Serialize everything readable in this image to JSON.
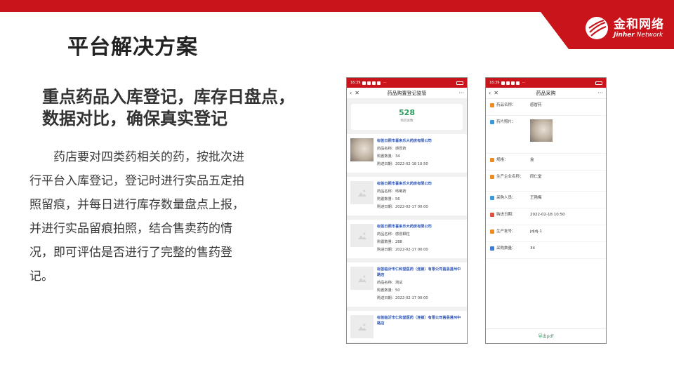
{
  "slide": {
    "title": "平台解决方案",
    "headline_line1": "重点药品入库登记，库存日盘点，",
    "headline_line2": "数据对比，确保真实登记",
    "body": "药店要对四类药相关的药，按批次进行平台入库登记，登记时进行实品五定拍照留痕，并每日进行库存数量盘点上报，并进行实品留痕拍照，结合售卖药的情况，即可评估是否进行了完整的售药登记。"
  },
  "brand": {
    "name_cn": "金和网络",
    "name_en_bold": "Jinher",
    "name_en_rest": "Network",
    "color": "#c8141a"
  },
  "left_phone": {
    "status_time": "16:39",
    "status_more": "···",
    "back_icon": "‹",
    "close_icon": "✕",
    "title": "药品购置登记监管",
    "more_icon": "···",
    "total_count": "528",
    "total_label": "购药总数",
    "records": [
      {
        "store": "标签日照市喜来乐大药房有限公司",
        "name": "药品名称：感冒药",
        "quantity": "购置数量：34",
        "date": "购进日期：2022-02-18 10:50",
        "has_photo": true
      },
      {
        "store": "标签日照市喜来乐大药房有限公司",
        "name": "药品名称：咳嗽药",
        "quantity": "购置数量：56",
        "date": "购进日期：2022-02-17 00:00",
        "has_photo": false
      },
      {
        "store": "标签日照市喜来乐大药房有限公司",
        "name": "药品名称：感冒颗粒",
        "quantity": "购置数量：288",
        "date": "购进日期：2022-02-17 00:00",
        "has_photo": false
      },
      {
        "store": "标签临沂市仁和堂医药（连锁）有限公司莒县莒州中路店",
        "name": "药品名称：测试",
        "quantity": "购置数量：50",
        "date": "购进日期：2022-02-17 00:00",
        "has_photo": false
      },
      {
        "store": "标签临沂市仁和堂医药（连锁）有限公司莒县莒州中路店",
        "name": "",
        "quantity": "",
        "date": "",
        "has_photo": false
      }
    ]
  },
  "right_phone": {
    "status_time": "16:39",
    "status_more": "···",
    "back_icon": "‹",
    "close_icon": "✕",
    "title": "药品采购",
    "more_icon": "···",
    "fields": {
      "name_label": "药品名称：",
      "name_value": "感冒药",
      "photo_label": "药片照片：",
      "spec_label": "规格：",
      "spec_value": "盒",
      "maker_label": "生产企业名称：",
      "maker_value": "同仁堂",
      "buyer_label": "采购人员：",
      "buyer_value": "王艳梅",
      "date_label": "购进日期：",
      "date_value": "2022-02-18 10:50",
      "batch_label": "生产批号：",
      "batch_value": "jdjdj-1",
      "qty_label": "采购数量：",
      "qty_value": "34"
    },
    "icon_colors": {
      "name": "#f08a24",
      "photo": "#3a9ad9",
      "spec": "#f08a24",
      "maker": "#f08a24",
      "buyer": "#3a9ad9",
      "date": "#e0503c",
      "batch": "#f08a24",
      "qty": "#3a7ad9"
    },
    "export_label": "导出pdf"
  }
}
